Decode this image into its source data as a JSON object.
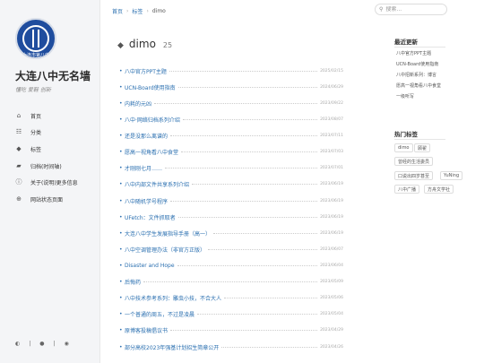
{
  "site": {
    "title": "大连八中无名墙",
    "subtitle": "懂吃 爱鞋 创新",
    "logo_text": "大连市第八中"
  },
  "nav": [
    {
      "icon": "home-icon",
      "glyph": "⌂",
      "label": "首页"
    },
    {
      "icon": "grid-icon",
      "glyph": "☷",
      "label": "分类"
    },
    {
      "icon": "tags-icon",
      "glyph": "◆",
      "label": "标签"
    },
    {
      "icon": "archive-icon",
      "glyph": "▰",
      "label": "归档(时间轴)"
    },
    {
      "icon": "info-icon",
      "glyph": "ⓘ",
      "label": "关于(说明)更多信息"
    },
    {
      "icon": "globe-icon",
      "glyph": "⊕",
      "label": "网站状态页面"
    }
  ],
  "footer_icons": [
    "theme-icon",
    "github-icon",
    "rss-icon"
  ],
  "breadcrumb": {
    "home": "首页",
    "section": "标签",
    "current": "dimo",
    "sep": "›"
  },
  "search": {
    "placeholder": "搜索..."
  },
  "tag_header": {
    "name": "dimo",
    "count": "25"
  },
  "posts": [
    {
      "title": "八中官方PPT主题",
      "date": "2025/02/15"
    },
    {
      "title": "UCN-Board使用指南",
      "date": "2024/06/29"
    },
    {
      "title": "内耗的元凶",
      "date": "2023/09/22"
    },
    {
      "title": "八中·网络归档系列介绍",
      "date": "2023/08/07"
    },
    {
      "title": "还是没那么离谱的",
      "date": "2023/07/11"
    },
    {
      "title": "愿高一视角看八中食堂",
      "date": "2023/07/03"
    },
    {
      "title": "才刚刚七月……",
      "date": "2023/07/01"
    },
    {
      "title": "八中内部文件共享系列介绍",
      "date": "2023/06/19"
    },
    {
      "title": "八中随机学号程序",
      "date": "2023/06/19"
    },
    {
      "title": "UFetch：文件抓取者",
      "date": "2023/06/19"
    },
    {
      "title": "大连八中学生发展指导手册（高一）",
      "date": "2023/06/19"
    },
    {
      "title": "八中空调管理办法（非官方正版）",
      "date": "2023/06/07"
    },
    {
      "title": "Disaster and Hope",
      "date": "2023/06/04"
    },
    {
      "title": "后悔药",
      "date": "2023/05/09"
    },
    {
      "title": "八中技术参考系列：雕虫小技，不合大人",
      "date": "2023/05/06"
    },
    {
      "title": "一个普通的周五，不过是凌晨",
      "date": "2023/05/04"
    },
    {
      "title": "原博客投稿倡议书",
      "date": "2023/04/29"
    },
    {
      "title": "部分高校2023年强基计划招生简章公开",
      "date": "2023/04/26"
    }
  ],
  "recent": {
    "title": "最近更新",
    "items": [
      "八中官方PPT主题",
      "UCN-Board使用指南",
      "八中招新系列：博言",
      "愿高一视角看八中食堂",
      "一级听写"
    ]
  },
  "hot_tags": {
    "title": "热门标签",
    "tags": [
      "dimo",
      "顾翟",
      "曾经的生活委员",
      "口说出四岁甚至",
      "YuNing",
      "八中广播",
      "方舟文学社"
    ]
  }
}
